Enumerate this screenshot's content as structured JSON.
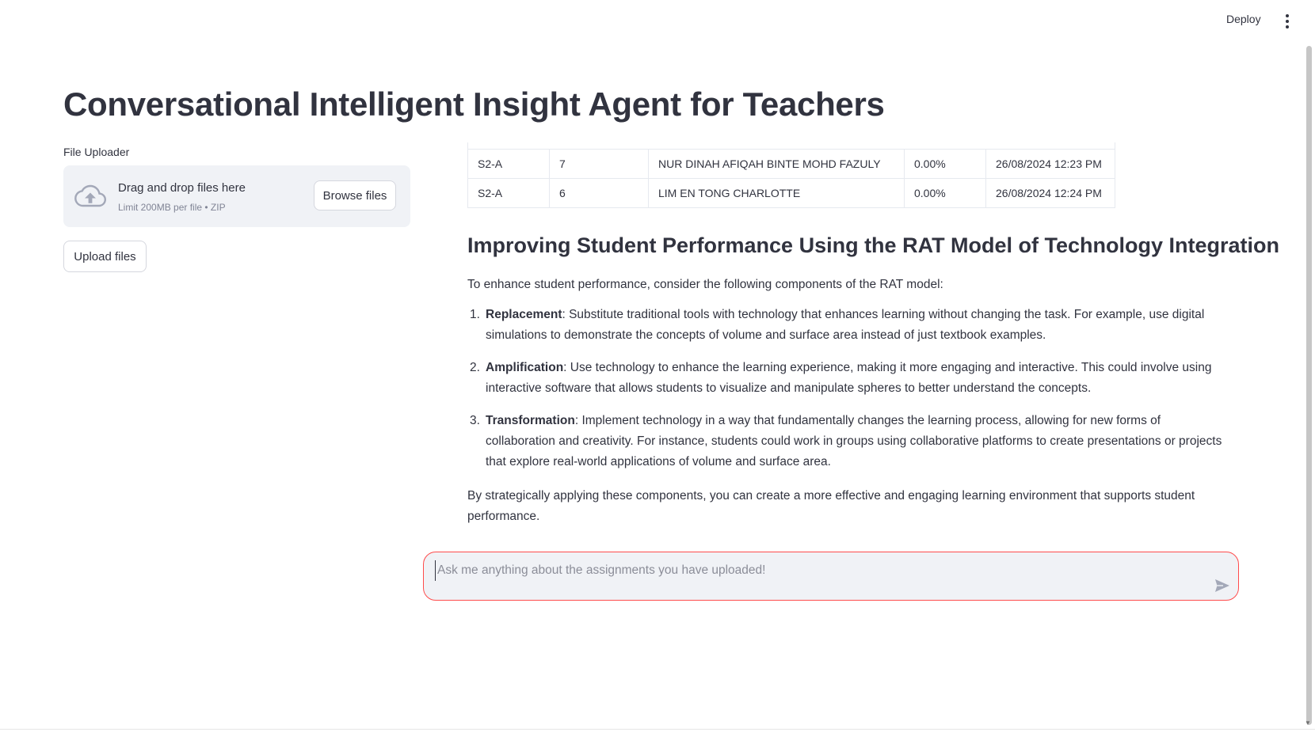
{
  "header": {
    "deploy_label": "Deploy"
  },
  "page": {
    "title": "Conversational Intelligent Insight Agent for Teachers"
  },
  "uploader": {
    "label": "File Uploader",
    "dropzone_title": "Drag and drop files here",
    "dropzone_sub": "Limit 200MB per file • ZIP",
    "browse_label": "Browse files",
    "upload_label": "Upload files"
  },
  "table": {
    "rows": [
      [
        "S2-A",
        "7",
        "NUR DINAH AFIQAH BINTE MOHD FAZULY",
        "0.00%",
        "26/08/2024 12:23 PM"
      ],
      [
        "S2-A",
        "6",
        "LIM EN TONG CHARLOTTE",
        "0.00%",
        "26/08/2024 12:24 PM"
      ]
    ]
  },
  "response": {
    "heading": "Improving Student Performance Using the RAT Model of Technology Integration",
    "intro": "To enhance student performance, consider the following components of the RAT model:",
    "items": [
      {
        "num": "1.",
        "term": "Replacement",
        "text": ": Substitute traditional tools with technology that enhances learning without changing the task. For example, use digital simulations to demonstrate the concepts of volume and surface area instead of just textbook examples."
      },
      {
        "num": "2.",
        "term": "Amplification",
        "text": ": Use technology to enhance the learning experience, making it more engaging and interactive. This could involve using interactive software that allows students to visualize and manipulate spheres to better understand the concepts."
      },
      {
        "num": "3.",
        "term": "Transformation",
        "text": ": Implement technology in a way that fundamentally changes the learning process, allowing for new forms of collaboration and creativity. For instance, students could work in groups using collaborative platforms to create presentations or projects that explore real-world applications of volume and surface area."
      }
    ],
    "conclusion": "By strategically applying these components, you can create a more effective and engaging learning environment that supports student performance."
  },
  "chat": {
    "placeholder": "Ask me anything about the assignments you have uploaded!",
    "value": ""
  },
  "colors": {
    "accent_border": "#ff4b4b",
    "text": "#31333f",
    "panel_bg": "#f0f2f6"
  },
  "icons": {
    "upload": "cloud-upload-icon",
    "send": "send-icon",
    "menu": "kebab-menu-icon"
  }
}
